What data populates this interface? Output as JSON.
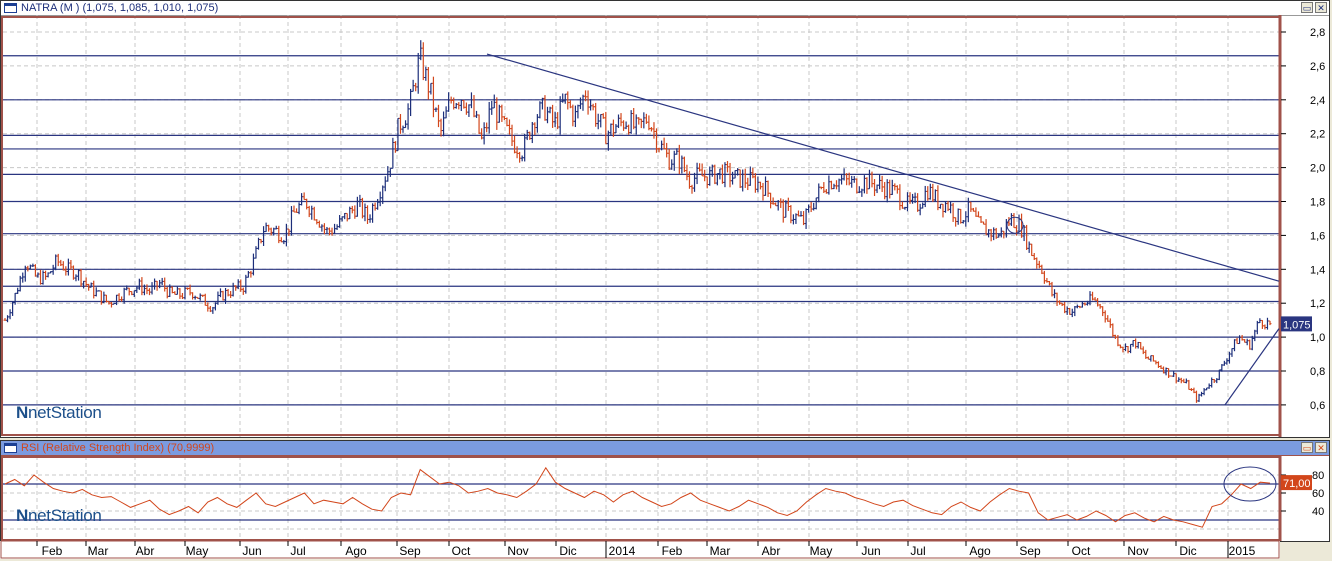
{
  "main_panel": {
    "title": "NATRA (M ) (1,075, 1,085, 1,010, 1,075)",
    "last_price_label": "1,075",
    "logo": "netStation"
  },
  "rsi_panel": {
    "title": "RSI (Relative Strength Index) (70,9999)",
    "last_value_label": "71,00",
    "logo": "netStation"
  },
  "colors": {
    "up": "#1c2e7a",
    "down": "#d2461b",
    "line": "#2a3580",
    "rsi": "#d2461b",
    "rsi_header": "#7b9be0",
    "frame": "#a0524a"
  },
  "chart_data": [
    {
      "type": "ohlc",
      "title": "NATRA (M )",
      "ylim": [
        0.5,
        2.9
      ],
      "yticks": [
        "2,8",
        "2,6",
        "2,4",
        "2,2",
        "2,0",
        "1,8",
        "1,6",
        "1,4",
        "1,2",
        "1,0",
        "0,8",
        "0,6"
      ],
      "ytick_values": [
        2.8,
        2.6,
        2.4,
        2.2,
        2.0,
        1.8,
        1.6,
        1.4,
        1.2,
        1.0,
        0.8,
        0.6
      ],
      "horizontal_levels": [
        2.66,
        2.4,
        2.19,
        2.11,
        1.96,
        1.8,
        1.61,
        1.4,
        1.3,
        1.21,
        1.0,
        0.8,
        0.6
      ],
      "closes": [
        1.1,
        1.25,
        1.45,
        1.35,
        1.35,
        1.45,
        1.4,
        1.38,
        1.3,
        1.25,
        1.2,
        1.25,
        1.28,
        1.3,
        1.27,
        1.32,
        1.25,
        1.25,
        1.27,
        1.22,
        1.18,
        1.25,
        1.28,
        1.3,
        1.45,
        1.65,
        1.63,
        1.6,
        1.75,
        1.8,
        1.72,
        1.62,
        1.65,
        1.72,
        1.78,
        1.7,
        1.85,
        2.0,
        2.25,
        2.35,
        2.65,
        2.45,
        2.2,
        2.4,
        2.42,
        2.35,
        2.15,
        2.38,
        2.25,
        2.15,
        2.1,
        2.3,
        2.35,
        2.25,
        2.4,
        2.3,
        2.45,
        2.3,
        2.2,
        2.25,
        2.28,
        2.22,
        2.3,
        2.15,
        2.05,
        2.05,
        1.93,
        1.95,
        1.95,
        1.97,
        1.95,
        1.93,
        1.92,
        1.9,
        1.82,
        1.75,
        1.72,
        1.68,
        1.8,
        1.9,
        1.93,
        1.92,
        1.9,
        1.92,
        1.9,
        1.88,
        1.85,
        1.78,
        1.78,
        1.87,
        1.8,
        1.78,
        1.7,
        1.75,
        1.65,
        1.62,
        1.6,
        1.7,
        1.65,
        1.5,
        1.4,
        1.25,
        1.18,
        1.15,
        1.2,
        1.22,
        1.15,
        1.0,
        0.93,
        0.97,
        0.88,
        0.85,
        0.8,
        0.76,
        0.72,
        0.63,
        0.72,
        0.78,
        0.9,
        1.0,
        0.95,
        1.1,
        1.075
      ]
    },
    {
      "type": "line",
      "title": "RSI (Relative Strength Index)",
      "ylim": [
        15,
        90
      ],
      "yticks": [
        "80",
        "60",
        "40"
      ],
      "ytick_values": [
        80,
        60,
        40
      ],
      "levels": [
        70,
        30
      ],
      "values": [
        70,
        75,
        68,
        80,
        72,
        65,
        62,
        60,
        64,
        58,
        55,
        56,
        50,
        44,
        48,
        52,
        42,
        36,
        40,
        45,
        38,
        50,
        55,
        48,
        44,
        52,
        60,
        48,
        45,
        50,
        55,
        60,
        48,
        52,
        50,
        48,
        55,
        48,
        42,
        40,
        55,
        60,
        58,
        86,
        78,
        70,
        72,
        68,
        60,
        62,
        65,
        60,
        58,
        55,
        62,
        70,
        88,
        72,
        65,
        60,
        55,
        62,
        58,
        50,
        58,
        62,
        55,
        50,
        45,
        48,
        55,
        60,
        52,
        48,
        44,
        40,
        45,
        52,
        48,
        44,
        38,
        35,
        40,
        50,
        58,
        65,
        62,
        60,
        55,
        52,
        48,
        45,
        50,
        52,
        46,
        42,
        38,
        36,
        45,
        50,
        44,
        40,
        50,
        58,
        65,
        62,
        60,
        38,
        30,
        33,
        36,
        30,
        34,
        40,
        35,
        28,
        35,
        38,
        32,
        28,
        34,
        30,
        28,
        25,
        22,
        45,
        48,
        58,
        70,
        65,
        72,
        71
      ]
    },
    {
      "type": "axis",
      "months": [
        "Feb",
        "Mar",
        "Abr",
        "May",
        "Jun",
        "Jul",
        "Ago",
        "Sep",
        "Oct",
        "Nov",
        "Dic",
        "2014",
        "Feb",
        "Mar",
        "Abr",
        "May",
        "Jun",
        "Jul",
        "Ago",
        "Sep",
        "Oct",
        "Nov",
        "Dic",
        "2015"
      ]
    }
  ]
}
